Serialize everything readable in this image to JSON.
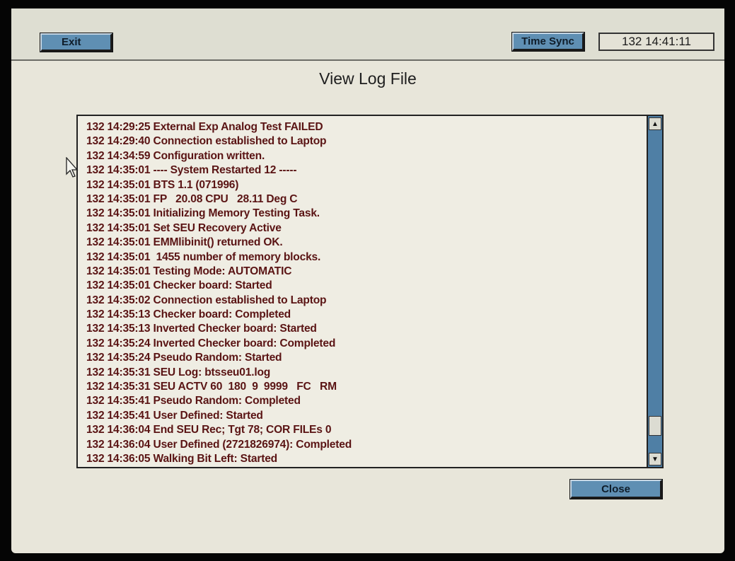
{
  "toolbar": {
    "exit_label": "Exit",
    "time_sync_label": "Time Sync",
    "time_display": "132 14:41:11"
  },
  "dialog": {
    "title": "View Log File",
    "close_label": "Close"
  },
  "log": {
    "lines": [
      "132 14:29:25 External Exp Analog Test FAILED",
      "132 14:29:40 Connection established to Laptop",
      "132 14:34:59 Configuration written.",
      "132 14:35:01 ---- System Restarted 12 -----",
      "132 14:35:01 BTS 1.1 (071996)",
      "132 14:35:01 FP   20.08 CPU   28.11 Deg C",
      "132 14:35:01 Initializing Memory Testing Task.",
      "132 14:35:01 Set SEU Recovery Active",
      "132 14:35:01 EMMlibinit() returned OK.",
      "132 14:35:01  1455 number of memory blocks.",
      "132 14:35:01 Testing Mode: AUTOMATIC",
      "132 14:35:01 Checker board: Started",
      "132 14:35:02 Connection established to Laptop",
      "132 14:35:13 Checker board: Completed",
      "132 14:35:13 Inverted Checker board: Started",
      "132 14:35:24 Inverted Checker board: Completed",
      "132 14:35:24 Pseudo Random: Started",
      "132 14:35:31 SEU Log: btsseu01.log",
      "132 14:35:31 SEU ACTV 60  180  9  9999   FC   RM",
      "132 14:35:41 Pseudo Random: Completed",
      "132 14:35:41 User Defined: Started",
      "132 14:36:04 End SEU Rec; Tgt 78; COR FILEs 0",
      "132 14:36:04 User Defined (2721826974): Completed",
      "132 14:36:05 Walking Bit Left: Started"
    ]
  },
  "icons": {
    "scroll_up": "up-arrow-icon",
    "scroll_down": "down-arrow-icon",
    "cursor": "mouse-pointer-icon"
  },
  "colors": {
    "button_blue": "#5f8fb3",
    "log_text": "#5a1414",
    "background": "#e8e6da"
  }
}
